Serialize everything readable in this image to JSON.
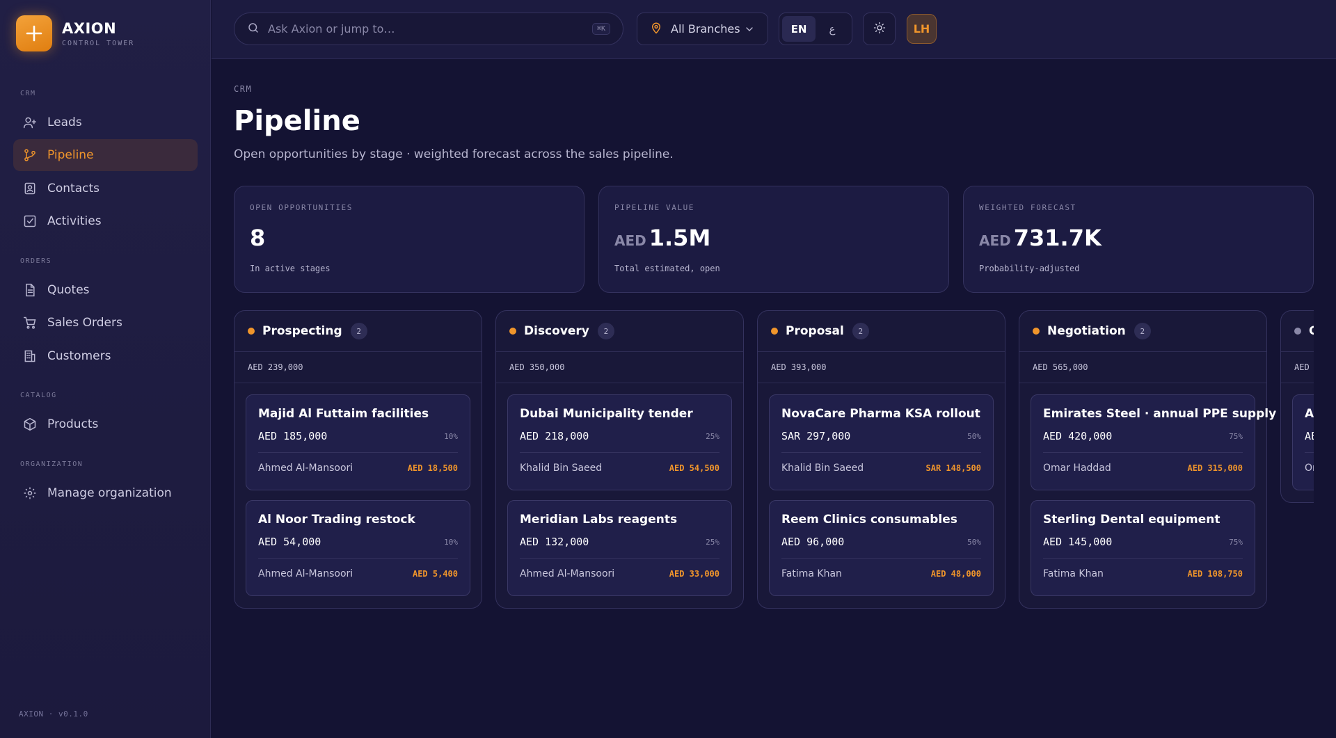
{
  "brand": {
    "name": "AXION",
    "subtitle": "CONTROL TOWER",
    "version": "AXION · v0.1.0"
  },
  "sidebar": {
    "sections": [
      {
        "label": "CRM",
        "items": [
          {
            "label": "Leads",
            "icon": "user-plus-icon"
          },
          {
            "label": "Pipeline",
            "icon": "git-branch-icon",
            "active": true
          },
          {
            "label": "Contacts",
            "icon": "contact-card-icon"
          },
          {
            "label": "Activities",
            "icon": "check-square-icon"
          }
        ]
      },
      {
        "label": "ORDERS",
        "items": [
          {
            "label": "Quotes",
            "icon": "document-icon"
          },
          {
            "label": "Sales Orders",
            "icon": "cart-icon"
          },
          {
            "label": "Customers",
            "icon": "building-icon"
          }
        ]
      },
      {
        "label": "CATALOG",
        "items": [
          {
            "label": "Products",
            "icon": "box-icon"
          }
        ]
      },
      {
        "label": "ORGANIZATION",
        "items": [
          {
            "label": "Manage organization",
            "icon": "gear-icon"
          }
        ]
      }
    ]
  },
  "topbar": {
    "search_placeholder": "Ask Axion or jump to…",
    "search_shortcut": "⌘K",
    "branch": "All Branches",
    "lang_en": "EN",
    "lang_ar": "ع",
    "avatar_initials": "LH"
  },
  "page": {
    "breadcrumb": "CRM",
    "title": "Pipeline",
    "subtitle": "Open opportunities by stage · weighted forecast across the sales pipeline."
  },
  "stats": [
    {
      "label": "OPEN OPPORTUNITIES",
      "currency": "",
      "value": "8",
      "note": "In active stages"
    },
    {
      "label": "PIPELINE VALUE",
      "currency": "AED",
      "value": "1.5M",
      "note": "Total estimated, open"
    },
    {
      "label": "WEIGHTED FORECAST",
      "currency": "AED",
      "value": "731.7K",
      "note": "Probability-adjusted"
    }
  ],
  "columns": [
    {
      "title": "Prospecting",
      "count": "2",
      "total": "AED 239,000",
      "dot_color": "#f0952b",
      "deals": [
        {
          "name": "Majid Al Futtaim facilities",
          "amount": "AED 185,000",
          "prob": "10%",
          "owner": "Ahmed Al-Mansoori",
          "weighted": "AED 18,500"
        },
        {
          "name": "Al Noor Trading restock",
          "amount": "AED 54,000",
          "prob": "10%",
          "owner": "Ahmed Al-Mansoori",
          "weighted": "AED 5,400"
        }
      ]
    },
    {
      "title": "Discovery",
      "count": "2",
      "total": "AED 350,000",
      "dot_color": "#f0952b",
      "deals": [
        {
          "name": "Dubai Municipality tender",
          "amount": "AED 218,000",
          "prob": "25%",
          "owner": "Khalid Bin Saeed",
          "weighted": "AED 54,500"
        },
        {
          "name": "Meridian Labs reagents",
          "amount": "AED 132,000",
          "prob": "25%",
          "owner": "Ahmed Al-Mansoori",
          "weighted": "AED 33,000"
        }
      ]
    },
    {
      "title": "Proposal",
      "count": "2",
      "total": "AED 393,000",
      "dot_color": "#f0952b",
      "deals": [
        {
          "name": "NovaCare Pharma KSA rollout",
          "amount": "SAR 297,000",
          "prob": "50%",
          "owner": "Khalid Bin Saeed",
          "weighted": "SAR 148,500"
        },
        {
          "name": "Reem Clinics consumables",
          "amount": "AED 96,000",
          "prob": "50%",
          "owner": "Fatima Khan",
          "weighted": "AED 48,000"
        }
      ]
    },
    {
      "title": "Negotiation",
      "count": "2",
      "total": "AED 565,000",
      "dot_color": "#f0952b",
      "deals": [
        {
          "name": "Emirates Steel · annual PPE supply",
          "amount": "AED 420,000",
          "prob": "75%",
          "owner": "Omar Haddad",
          "weighted": "AED 315,000"
        },
        {
          "name": "Sterling Dental equipment",
          "amount": "AED 145,000",
          "prob": "75%",
          "owner": "Fatima Khan",
          "weighted": "AED 108,750"
        }
      ]
    },
    {
      "title": "C",
      "count": "",
      "total": "AED",
      "dot_color": "#8a88a8",
      "deals": [
        {
          "name": "A",
          "amount": "AE",
          "prob": "",
          "owner": "Or",
          "weighted": ""
        }
      ]
    }
  ]
}
